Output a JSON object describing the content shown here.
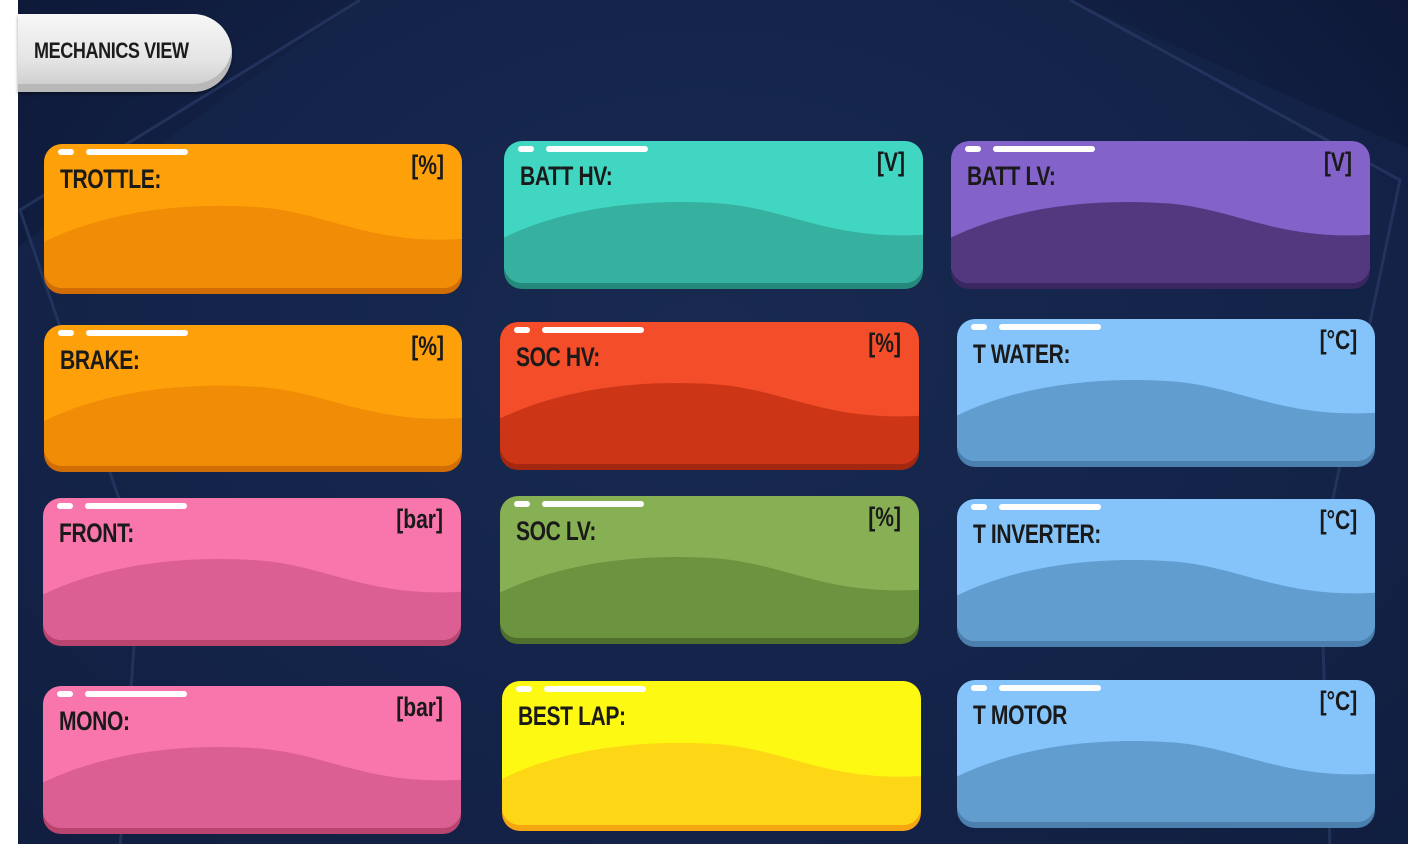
{
  "header": {
    "view_label": "MECHANICS VIEW"
  },
  "cards": [
    {
      "id": "trottle",
      "label": "TROTTLE:",
      "unit": "[%]",
      "color": "#fea00a",
      "shade": "#f08c05",
      "base": "#d06d05"
    },
    {
      "id": "brake",
      "label": "BRAKE:",
      "unit": "[%]",
      "color": "#fea00a",
      "shade": "#f08c05",
      "base": "#d06d05"
    },
    {
      "id": "front",
      "label": "FRONT:",
      "unit": "[bar]",
      "color": "#f876ab",
      "shade": "#dc5f93",
      "base": "#b8446f"
    },
    {
      "id": "mono",
      "label": "MONO:",
      "unit": "[bar]",
      "color": "#f876ab",
      "shade": "#dc5f93",
      "base": "#b8446f"
    },
    {
      "id": "batt-hv",
      "label": "BATT HV:",
      "unit": "[V]",
      "color": "#41d6c2",
      "shade": "#36b09f",
      "base": "#24887a"
    },
    {
      "id": "soc-hv",
      "label": "SOC HV:",
      "unit": "[%]",
      "color": "#f44d2a",
      "shade": "#cc3617",
      "base": "#a3280f"
    },
    {
      "id": "soc-lv",
      "label": "SOC LV:",
      "unit": "[%]",
      "color": "#86b053",
      "shade": "#6c9340",
      "base": "#4f6f2c"
    },
    {
      "id": "best-lap",
      "label": "BEST LAP:",
      "unit": "",
      "color": "#fdf912",
      "shade": "#fdd615",
      "base": "#f6a611"
    },
    {
      "id": "batt-lv",
      "label": "BATT LV:",
      "unit": "[V]",
      "color": "#8362c9",
      "shade": "#52397f",
      "base": "#3a2761"
    },
    {
      "id": "t-water",
      "label": "T WATER:",
      "unit": "[°C]",
      "color": "#85c4fb",
      "shade": "#629dcf",
      "base": "#4a7fae"
    },
    {
      "id": "t-inverter",
      "label": "T INVERTER:",
      "unit": "[°C]",
      "color": "#85c4fb",
      "shade": "#629dcf",
      "base": "#4a7fae"
    },
    {
      "id": "t-motor",
      "label": "T MOTOR",
      "unit": "[°C]",
      "color": "#85c4fb",
      "shade": "#629dcf",
      "base": "#4a7fae"
    }
  ]
}
